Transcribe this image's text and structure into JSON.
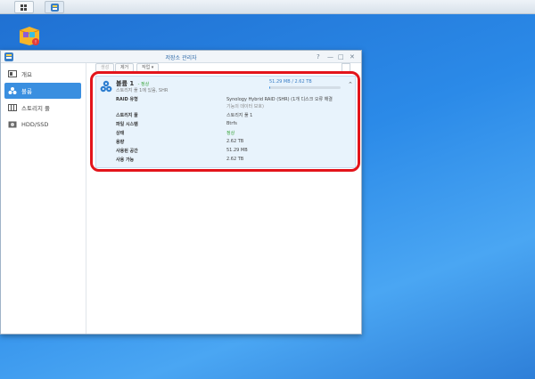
{
  "window": {
    "title": "저장소 관리자",
    "controls": [
      "?",
      "—",
      "□",
      "✕"
    ]
  },
  "sidebar": {
    "items": [
      {
        "label": "개요",
        "icon": "overview-icon",
        "active": false
      },
      {
        "label": "볼륨",
        "icon": "volume-icon",
        "active": true
      },
      {
        "label": "스토리지 풀",
        "icon": "storage-pool-icon",
        "active": false
      },
      {
        "label": "HDD/SSD",
        "icon": "hdd-icon",
        "active": false
      }
    ]
  },
  "toolbar": {
    "create_label": "생성",
    "remove_label": "제거",
    "action_label": "작업 ▾"
  },
  "volume": {
    "name": "볼륨 1",
    "status_inline": "- 정상",
    "subtitle": "스토리지 풀 1에 있음, SHR",
    "usage_text": "51.29 MB / 2.62 TB",
    "usage_fraction": 2e-05,
    "details": [
      {
        "key": "RAID 유형",
        "value": "Synology Hybrid RAID (SHR) (1개 디스크 오류 해결",
        "value2": "기능의 데이터 보호)"
      },
      {
        "key": "스토리지 풀",
        "value": "스토리지 풀 1"
      },
      {
        "key": "파일 시스템",
        "value": "Btrfs"
      },
      {
        "key": "상태",
        "value": "정상",
        "ok": true
      },
      {
        "key": "용량",
        "value": "2.62 TB"
      },
      {
        "key": "사용된 공간",
        "value": "51.29 MB"
      },
      {
        "key": "사용 가능",
        "value": "2.62 TB"
      }
    ]
  },
  "colors": {
    "accent": "#3a8fe0",
    "highlight": "#e3141b",
    "ok": "#3aa43a"
  }
}
